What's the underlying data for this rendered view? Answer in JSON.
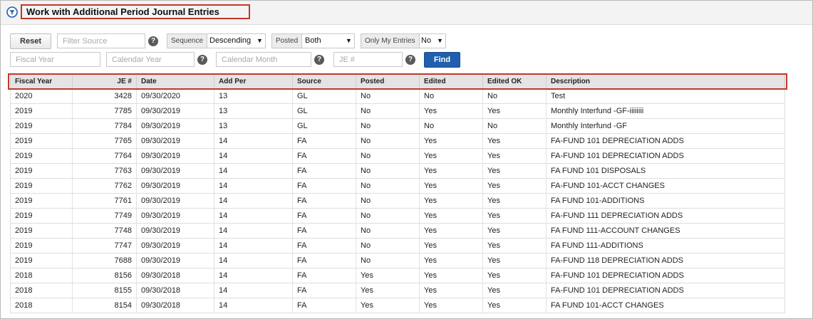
{
  "title": "Work with Additional Period Journal Entries",
  "colors": {
    "accent": "#1f5fae",
    "highlight": "#c0392b"
  },
  "filters": {
    "reset_label": "Reset",
    "filter_source_placeholder": "Filter Source",
    "sequence_label": "Sequence",
    "sequence_value": "Descending",
    "posted_label": "Posted",
    "posted_value": "Both",
    "only_my_entries_label": "Only My Entries",
    "only_my_entries_value": "No",
    "fiscal_year_placeholder": "Fiscal Year",
    "calendar_year_placeholder": "Calendar Year",
    "calendar_month_placeholder": "Calendar Month",
    "je_placeholder": "JE #",
    "find_label": "Find",
    "help_glyph": "?"
  },
  "table": {
    "columns": [
      "Fiscal Year",
      "JE #",
      "Date",
      "Add Per",
      "Source",
      "Posted",
      "Edited",
      "Edited OK",
      "Description"
    ],
    "rows": [
      [
        "2020",
        "3428",
        "09/30/2020",
        "13",
        "GL",
        "No",
        "No",
        "No",
        "Test"
      ],
      [
        "2019",
        "7785",
        "09/30/2019",
        "13",
        "GL",
        "No",
        "Yes",
        "Yes",
        "Monthly Interfund -GF-iiiiiiii"
      ],
      [
        "2019",
        "7784",
        "09/30/2019",
        "13",
        "GL",
        "No",
        "No",
        "No",
        "Monthly Interfund -GF"
      ],
      [
        "2019",
        "7765",
        "09/30/2019",
        "14",
        "FA",
        "No",
        "Yes",
        "Yes",
        "FA-FUND 101 DEPRECIATION ADDS"
      ],
      [
        "2019",
        "7764",
        "09/30/2019",
        "14",
        "FA",
        "No",
        "Yes",
        "Yes",
        "FA-FUND 101 DEPRECIATION ADDS"
      ],
      [
        "2019",
        "7763",
        "09/30/2019",
        "14",
        "FA",
        "No",
        "Yes",
        "Yes",
        "FA FUND 101 DISPOSALS"
      ],
      [
        "2019",
        "7762",
        "09/30/2019",
        "14",
        "FA",
        "No",
        "Yes",
        "Yes",
        "FA-FUND 101-ACCT CHANGES"
      ],
      [
        "2019",
        "7761",
        "09/30/2019",
        "14",
        "FA",
        "No",
        "Yes",
        "Yes",
        "FA FUND 101-ADDITIONS"
      ],
      [
        "2019",
        "7749",
        "09/30/2019",
        "14",
        "FA",
        "No",
        "Yes",
        "Yes",
        "FA-FUND 111 DEPRECIATION ADDS"
      ],
      [
        "2019",
        "7748",
        "09/30/2019",
        "14",
        "FA",
        "No",
        "Yes",
        "Yes",
        "FA FUND 111-ACCOUNT CHANGES"
      ],
      [
        "2019",
        "7747",
        "09/30/2019",
        "14",
        "FA",
        "No",
        "Yes",
        "Yes",
        "FA FUND 111-ADDITIONS"
      ],
      [
        "2019",
        "7688",
        "09/30/2019",
        "14",
        "FA",
        "No",
        "Yes",
        "Yes",
        "FA-FUND 118 DEPRECIATION ADDS"
      ],
      [
        "2018",
        "8156",
        "09/30/2018",
        "14",
        "FA",
        "Yes",
        "Yes",
        "Yes",
        "FA-FUND 101 DEPRECIATION ADDS"
      ],
      [
        "2018",
        "8155",
        "09/30/2018",
        "14",
        "FA",
        "Yes",
        "Yes",
        "Yes",
        "FA-FUND 101 DEPRECIATION ADDS"
      ],
      [
        "2018",
        "8154",
        "09/30/2018",
        "14",
        "FA",
        "Yes",
        "Yes",
        "Yes",
        "FA FUND 101-ACCT CHANGES"
      ]
    ]
  }
}
